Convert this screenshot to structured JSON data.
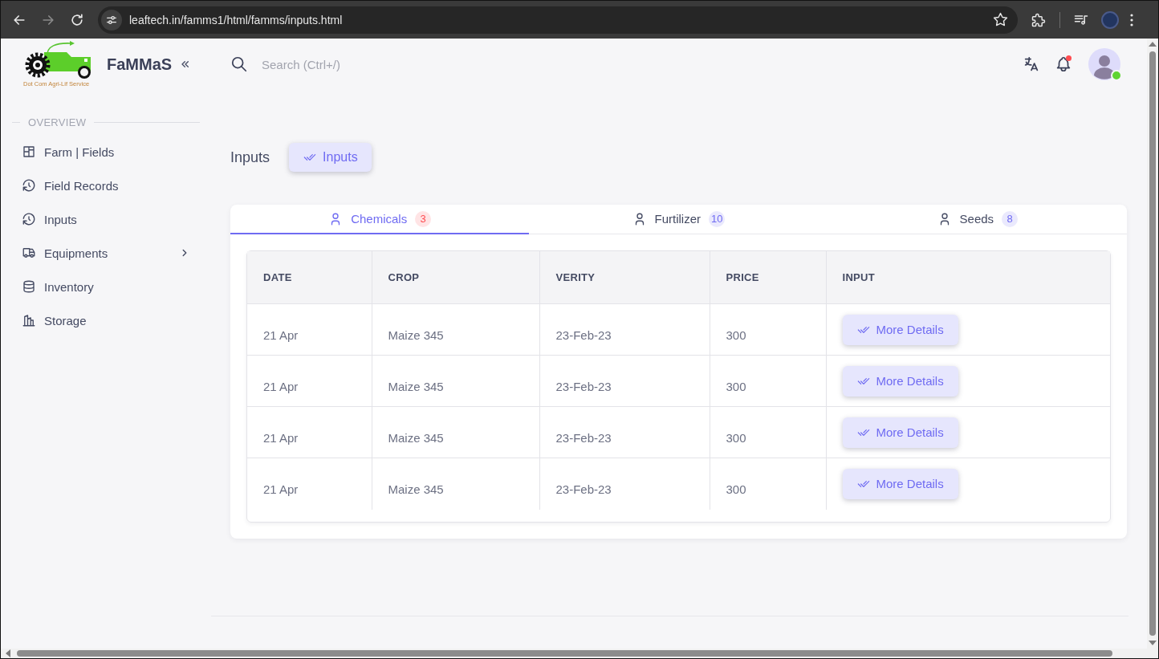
{
  "browser": {
    "url": "leaftech.in/famms1/html/famms/inputs.html",
    "forward_disabled": true
  },
  "sidebar": {
    "logo_caption": "Dot Com Agri-Lif Service",
    "brand": "FaMMaS",
    "section": "OVERVIEW",
    "items": [
      {
        "label": "Farm | Fields",
        "selected": false,
        "submenu": false
      },
      {
        "label": "Field Records",
        "selected": false,
        "submenu": false
      },
      {
        "label": "Inputs",
        "selected": false,
        "submenu": false
      },
      {
        "label": "Equipments",
        "selected": false,
        "submenu": true
      },
      {
        "label": "Inventory",
        "selected": false,
        "submenu": false
      },
      {
        "label": "Storage",
        "selected": false,
        "submenu": false
      }
    ]
  },
  "header": {
    "search": {
      "placeholder": "Search (Ctrl+/)"
    },
    "notifications_unread": true,
    "user_online": true
  },
  "page": {
    "title": "Inputs",
    "breadcrumb_button": "Inputs"
  },
  "tabs": [
    {
      "label": "Chemicals",
      "badge": "3",
      "color": "#ff4c51",
      "selected": true
    },
    {
      "label": "Furtilizer",
      "badge": "10",
      "color": "#6f6bf2",
      "selected": false
    },
    {
      "label": "Seeds",
      "badge": "8",
      "color": "#6f6bf2",
      "selected": false
    }
  ],
  "table": {
    "columns": [
      "DATE",
      "CROP",
      "VERITY",
      "PRICE",
      "INPUT"
    ],
    "rows": [
      {
        "cells": [
          "21 Apr",
          "Maize 345",
          "23-Feb-23",
          "300"
        ],
        "action": "More Details"
      },
      {
        "cells": [
          "21 Apr",
          "Maize 345",
          "23-Feb-23",
          "300"
        ],
        "action": "More Details"
      },
      {
        "cells": [
          "21 Apr",
          "Maize 345",
          "23-Feb-23",
          "300"
        ],
        "action": "More Details"
      },
      {
        "cells": [
          "21 Apr",
          "Maize 345",
          "23-Feb-23",
          "300"
        ],
        "action": "More Details"
      }
    ]
  }
}
